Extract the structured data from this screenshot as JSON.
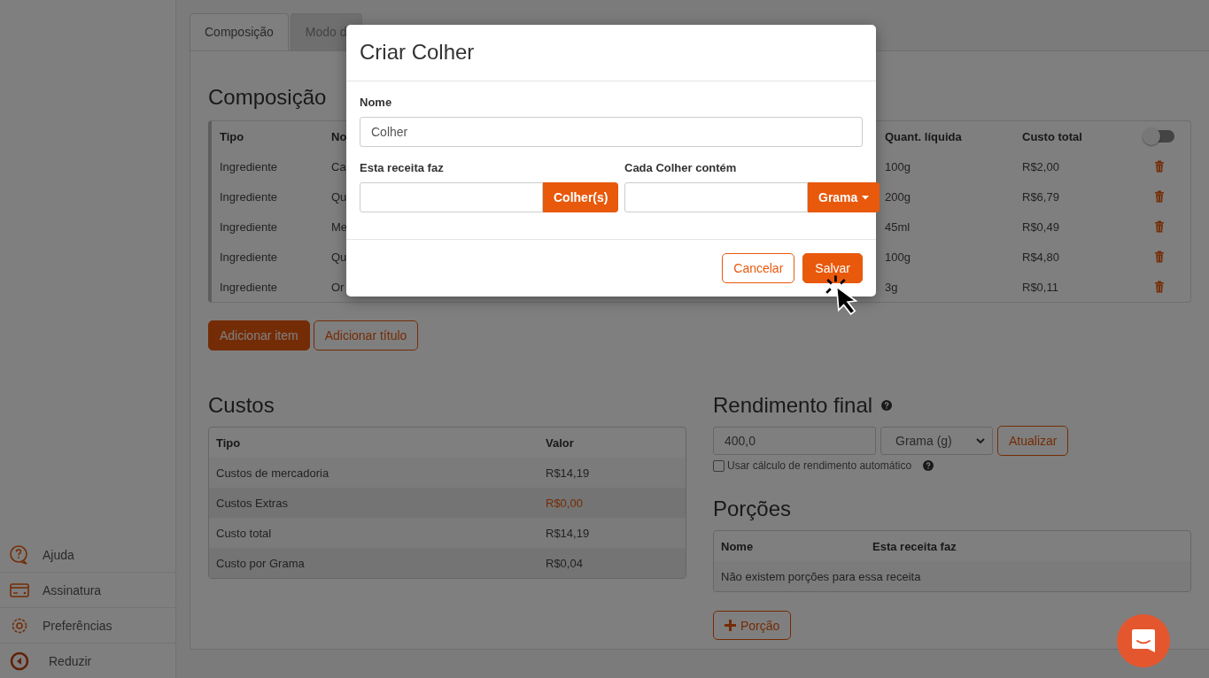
{
  "sidebar": {
    "items": [
      {
        "label": "Ajuda"
      },
      {
        "label": "Assinatura"
      },
      {
        "label": "Preferências"
      },
      {
        "label": "Reduzir"
      }
    ]
  },
  "tabs": [
    {
      "label": "Composição",
      "selected": true
    },
    {
      "label": "Modo d",
      "selected": false
    }
  ],
  "composition": {
    "title": "Composição",
    "columns": [
      "Tipo",
      "No",
      "Quant. líquida",
      "Custo total"
    ],
    "toggle": {
      "on": false
    },
    "rows": [
      {
        "type": "Ingrediente",
        "name": "Ca",
        "quantity": "100g",
        "cost": "R$2,00"
      },
      {
        "type": "Ingrediente",
        "name": "Qu",
        "quantity": "200g",
        "cost": "R$6,79"
      },
      {
        "type": "Ingrediente",
        "name": "Me",
        "quantity": "45ml",
        "cost": "R$0,49"
      },
      {
        "type": "Ingrediente",
        "name": "Qu",
        "quantity": "100g",
        "cost": "R$4,80"
      },
      {
        "type": "Ingrediente",
        "name": "Or",
        "quantity": "3g",
        "cost": "R$0,11"
      }
    ],
    "buttons": [
      {
        "label": "Adicionar item",
        "kind": "primary"
      },
      {
        "label": "Adicionar título",
        "kind": "outline"
      }
    ]
  },
  "costs": {
    "title": "Custos",
    "columns": [
      "Tipo",
      "Valor"
    ],
    "rows": [
      {
        "label": "Custos de mercadoria",
        "value": "R$14,19",
        "highlighted": false
      },
      {
        "label": "Custos Extras",
        "value": "R$0,00",
        "highlighted": true
      },
      {
        "label": "Custo total",
        "value": "R$14,19",
        "highlighted": false
      },
      {
        "label": "Custo por Grama",
        "value": "R$0,04",
        "highlighted": false
      }
    ]
  },
  "yield": {
    "title": "Rendimento final",
    "value": "400,0",
    "unit": "Grama (g)",
    "button": "Atualizar",
    "auto": {
      "label": "Usar cálculo de rendimento automático",
      "checked": false
    }
  },
  "portions": {
    "title": "Porções",
    "columns": [
      "Nome",
      "Esta receita faz"
    ],
    "empty": "Não existem porções para essa receita",
    "add_button": "Porção"
  },
  "modal": {
    "title": "Criar Colher",
    "name_label": "Nome",
    "name_value": "Colher",
    "makes_label": "Esta receita faz",
    "makes_unit": "Colher(s)",
    "contains_label": "Cada Colher contém",
    "contains_unit": "Grama",
    "buttons": [
      {
        "label": "Cancelar",
        "kind": "outline"
      },
      {
        "label": "Salvar",
        "kind": "primary"
      }
    ]
  }
}
